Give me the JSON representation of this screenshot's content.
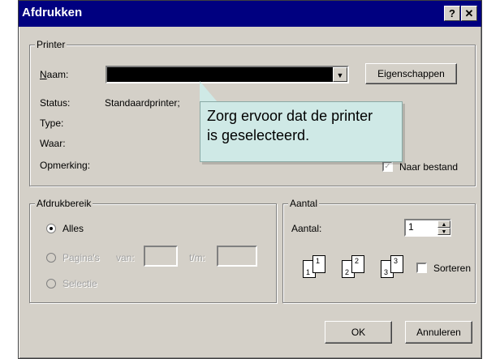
{
  "window": {
    "title": "Afdrukken",
    "help_button": "?",
    "close_button": "✕"
  },
  "printer_group": {
    "legend": "Printer",
    "name_label": "Naam:",
    "name_value": "",
    "properties_button": "Eigenschappen",
    "status_label": "Status:",
    "status_value": "Standaardprinter; ",
    "type_label": "Type:",
    "where_label": "Waar:",
    "comment_label": "Opmerking:",
    "print_to_file_label": "Naar bestand",
    "print_to_file_checked": true
  },
  "tooltip": {
    "line1": "Zorg ervoor dat de printer",
    "line2": "is geselecteerd."
  },
  "range_group": {
    "legend": "Afdrukbereik",
    "all_label": "Alles",
    "pages_label": "Pagina's",
    "from_label": "van:",
    "to_label": "t/m:",
    "selection_label": "Selectie",
    "selected": "all"
  },
  "copies_group": {
    "legend": "Aantal",
    "copies_label": "Aantal:",
    "copies_value": "1",
    "collate_label": "Sorteren",
    "collate_checked": false,
    "page_icons": [
      "1",
      "1",
      "2",
      "2",
      "3",
      "3"
    ]
  },
  "buttons": {
    "ok": "OK",
    "cancel": "Annuleren"
  }
}
